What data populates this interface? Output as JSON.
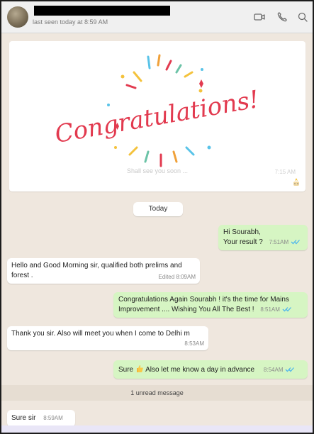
{
  "header": {
    "last_seen": "last seen today at 8:59 AM",
    "icons": [
      "video-call-icon",
      "phone-icon",
      "search-icon"
    ]
  },
  "media": {
    "banner_text": "Congratulations!",
    "caption": "Shall see you soon ... ",
    "time": "7:15 AM"
  },
  "date_chip": "Today",
  "messages": [
    {
      "dir": "out",
      "lines": [
        "Hi Sourabh,",
        "Your result ?"
      ],
      "time": "7:51AM",
      "ticks": true
    },
    {
      "dir": "in",
      "lines": [
        "Hello and Good Morning sir, qualified both prelims and",
        "forest ."
      ],
      "time": "Edited  8:09AM"
    },
    {
      "dir": "out",
      "lines": [
        "Congratulations Again Sourabh ! it's the time for Mains",
        "Improvement .... Wishing You All The Best !"
      ],
      "time": "8:51AM",
      "ticks": true
    },
    {
      "dir": "in",
      "lines": [
        "Thank you sir. Also will meet you when I come to Delhi m"
      ],
      "time": "8:53AM"
    },
    {
      "dir": "out",
      "lines": [
        "Sure",
        "Also let me know a day in advance"
      ],
      "time": "8:54AM",
      "ticks": true
    },
    {
      "dir": "in",
      "lines": [
        "Sure sir"
      ],
      "time": "8:59AM"
    }
  ],
  "unread": "1 unread message",
  "colors": {
    "outgoing_bubble": "#d6f5c3",
    "incoming_bubble": "#ffffff",
    "chat_bg": "#efe7de",
    "tick_blue": "#4fb6ec",
    "banner_red": "#e23a4f"
  }
}
